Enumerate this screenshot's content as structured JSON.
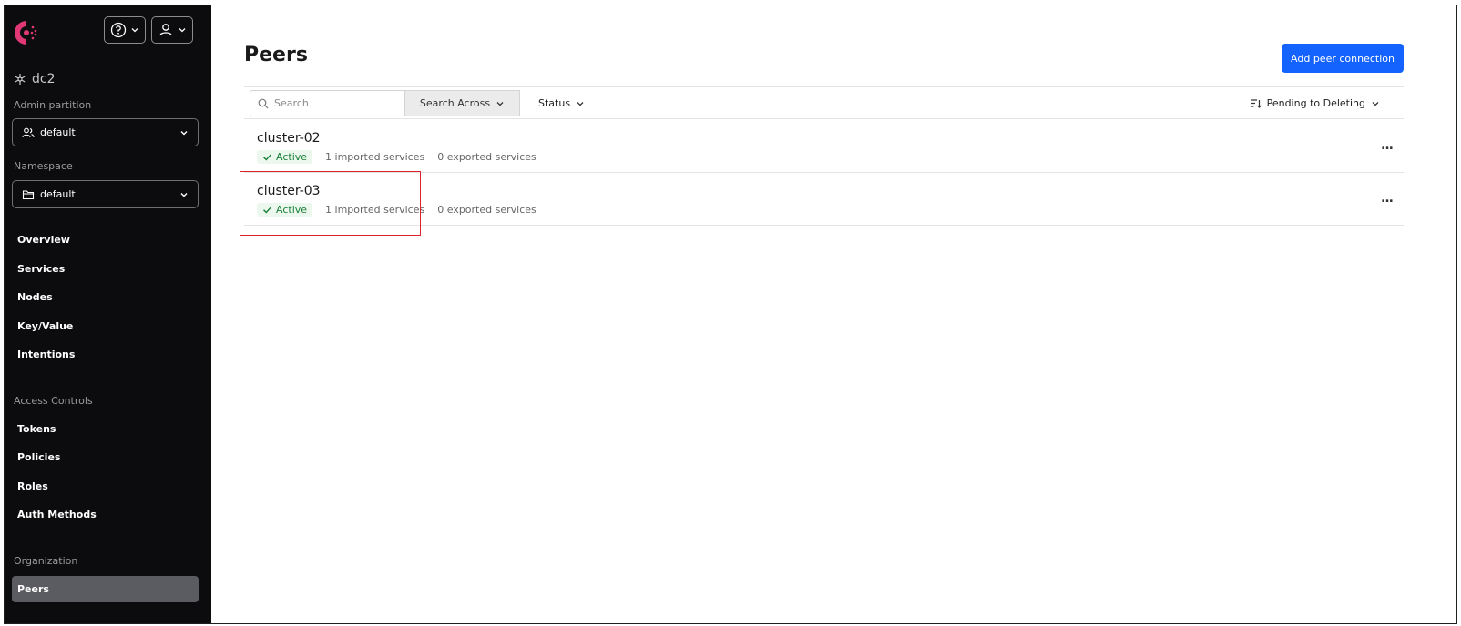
{
  "sidebar": {
    "datacenter": "dc2",
    "admin_partition_label": "Admin partition",
    "admin_partition_value": "default",
    "namespace_label": "Namespace",
    "namespace_value": "default",
    "nav_primary": [
      "Overview",
      "Services",
      "Nodes",
      "Key/Value",
      "Intentions"
    ],
    "access_controls_label": "Access Controls",
    "nav_access": [
      "Tokens",
      "Policies",
      "Roles",
      "Auth Methods"
    ],
    "organization_label": "Organization",
    "nav_org": [
      "Peers"
    ]
  },
  "main": {
    "title": "Peers",
    "add_button": "Add peer connection",
    "search_placeholder": "Search",
    "search_across": "Search Across",
    "status_filter": "Status",
    "sort_label": "Pending to Deleting",
    "peers": [
      {
        "name": "cluster-02",
        "status": "Active",
        "imported": "1 imported services",
        "exported": "0 exported services"
      },
      {
        "name": "cluster-03",
        "status": "Active",
        "imported": "1 imported services",
        "exported": "0 exported services"
      }
    ],
    "more": "..."
  },
  "colors": {
    "sidebar_bg": "#0c0c0e",
    "brand": "#e03875",
    "primary": "#1563ff",
    "active_green": "#198038",
    "highlight": "#e0202a"
  }
}
